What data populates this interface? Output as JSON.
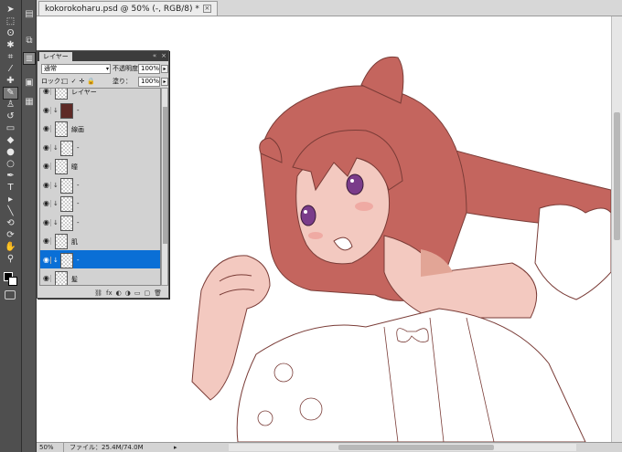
{
  "document": {
    "tab_title": "kokorokoharu.psd @ 50% (-, RGB/8) *",
    "close_glyph": "×"
  },
  "toolbar": {
    "tools": [
      {
        "name": "move-tool-icon",
        "glyph": "➤"
      },
      {
        "name": "marquee-tool-icon",
        "glyph": "⬚"
      },
      {
        "name": "lasso-tool-icon",
        "glyph": "ʘ"
      },
      {
        "name": "magic-wand-icon",
        "glyph": "✱"
      },
      {
        "name": "crop-tool-icon",
        "glyph": "⌗"
      },
      {
        "name": "eyedropper-icon",
        "glyph": "⁄"
      },
      {
        "name": "healing-brush-icon",
        "glyph": "✚"
      },
      {
        "name": "brush-tool-icon",
        "glyph": "✎",
        "active": true
      },
      {
        "name": "clone-stamp-icon",
        "glyph": "♙"
      },
      {
        "name": "history-brush-icon",
        "glyph": "↺"
      },
      {
        "name": "eraser-tool-icon",
        "glyph": "▭"
      },
      {
        "name": "paint-bucket-icon",
        "glyph": "◆"
      },
      {
        "name": "blur-tool-icon",
        "glyph": "●"
      },
      {
        "name": "dodge-tool-icon",
        "glyph": "○"
      },
      {
        "name": "pen-tool-icon",
        "glyph": "✒"
      },
      {
        "name": "type-tool-icon",
        "glyph": "T"
      },
      {
        "name": "path-select-icon",
        "glyph": "▸"
      },
      {
        "name": "line-tool-icon",
        "glyph": "╲"
      },
      {
        "name": "rotate-3d-icon",
        "glyph": "⟲"
      },
      {
        "name": "orbit-3d-icon",
        "glyph": "⟳"
      },
      {
        "name": "hand-tool-icon",
        "glyph": "✋"
      },
      {
        "name": "zoom-tool-icon",
        "glyph": "⚲"
      }
    ]
  },
  "dock": {
    "buttons": [
      {
        "name": "dock-history-icon",
        "glyph": "▤"
      },
      {
        "name": "dock-navigator-icon",
        "glyph": "⧉"
      },
      {
        "name": "dock-layers-icon",
        "glyph": "≣",
        "active": true
      },
      {
        "name": "dock-brush-icon",
        "glyph": "▣"
      },
      {
        "name": "dock-swatches-icon",
        "glyph": "▦"
      }
    ]
  },
  "layers_panel": {
    "tab_label": "レイヤー",
    "collapse_glyph": "«",
    "close_glyph": "×",
    "menu_glyph": "≡",
    "blend_mode": "通常",
    "dropdown_glyph": "▾",
    "opacity_label": "不透明度：",
    "opacity_value": "100%",
    "lock_label": "ロック：",
    "lock_icons": [
      "□",
      "✓",
      "✛",
      "🔒"
    ],
    "fill_label": "塗り：",
    "fill_value": "100%",
    "stepper_glyph": "▸",
    "eye_glyph": "👁",
    "clip_glyph": "↓",
    "layers": [
      {
        "name": "レイヤー",
        "thumb": "checker",
        "clip": false
      },
      {
        "name": "-",
        "thumb": "solid",
        "clip": true
      },
      {
        "name": "線画",
        "thumb": "checker",
        "clip": false
      },
      {
        "name": "-",
        "thumb": "checker",
        "clip": true
      },
      {
        "name": "瞳",
        "thumb": "checker",
        "clip": false
      },
      {
        "name": "-",
        "thumb": "checker",
        "clip": true
      },
      {
        "name": "-",
        "thumb": "checker",
        "clip": true
      },
      {
        "name": "-",
        "thumb": "checker",
        "clip": true
      },
      {
        "name": "肌",
        "thumb": "checker",
        "clip": false
      },
      {
        "name": "-",
        "thumb": "checker",
        "clip": true,
        "selected": true
      },
      {
        "name": "髪",
        "thumb": "checker",
        "clip": false
      }
    ],
    "bottom_icons": [
      "⛓",
      "fx",
      "◐",
      "◑",
      "▭",
      "▢",
      "🗑"
    ]
  },
  "status": {
    "zoom": "50%",
    "file_info": "ファイル：25.4M/74.0M",
    "arrow_glyph": "▸"
  },
  "colors": {
    "hair": "#c4655e",
    "hair_line": "#7a3c37",
    "skin": "#f3c9c0",
    "skin_shadow": "#e2a596",
    "eye": "#7a3c8a",
    "selection": "#0a6fd6"
  }
}
